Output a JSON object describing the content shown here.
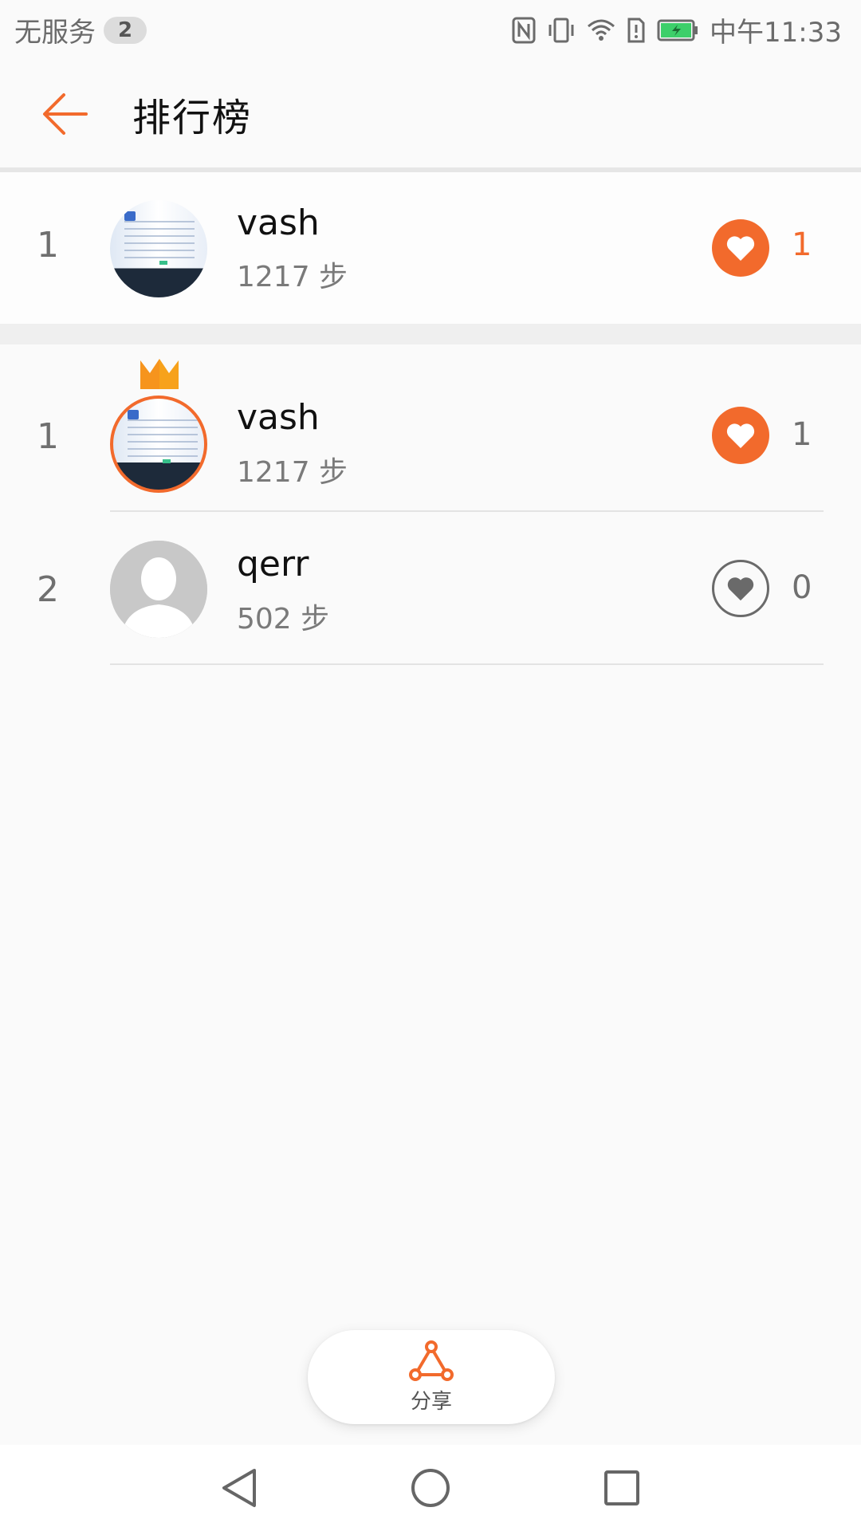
{
  "status_bar": {
    "carrier": "无服务",
    "sim_badge": "2",
    "time": "中午11:33",
    "icons": [
      "nfc-icon",
      "vibrate-icon",
      "wifi-icon",
      "sim-alert-icon",
      "battery-charging-icon"
    ]
  },
  "header": {
    "back_icon": "arrow-left-icon",
    "title": "排行榜"
  },
  "my_rank": {
    "rank": "1",
    "name": "vash",
    "steps": "1217 步",
    "likes": "1",
    "liked": true
  },
  "leaderboard": [
    {
      "rank": "1",
      "name": "vash",
      "steps": "1217 步",
      "likes": "1",
      "liked": true,
      "crown": true,
      "avatar": "photo"
    },
    {
      "rank": "2",
      "name": "qerr",
      "steps": "502 步",
      "likes": "0",
      "liked": false,
      "crown": false,
      "avatar": "default"
    }
  ],
  "share": {
    "icon": "share-icon",
    "label": "分享"
  },
  "nav": {
    "icons": [
      "back-triangle-icon",
      "home-circle-icon",
      "recents-square-icon"
    ]
  },
  "colors": {
    "accent": "#f26a2c",
    "text_primary": "#111111",
    "text_secondary": "#7a7a7a",
    "background": "#fafafa"
  }
}
